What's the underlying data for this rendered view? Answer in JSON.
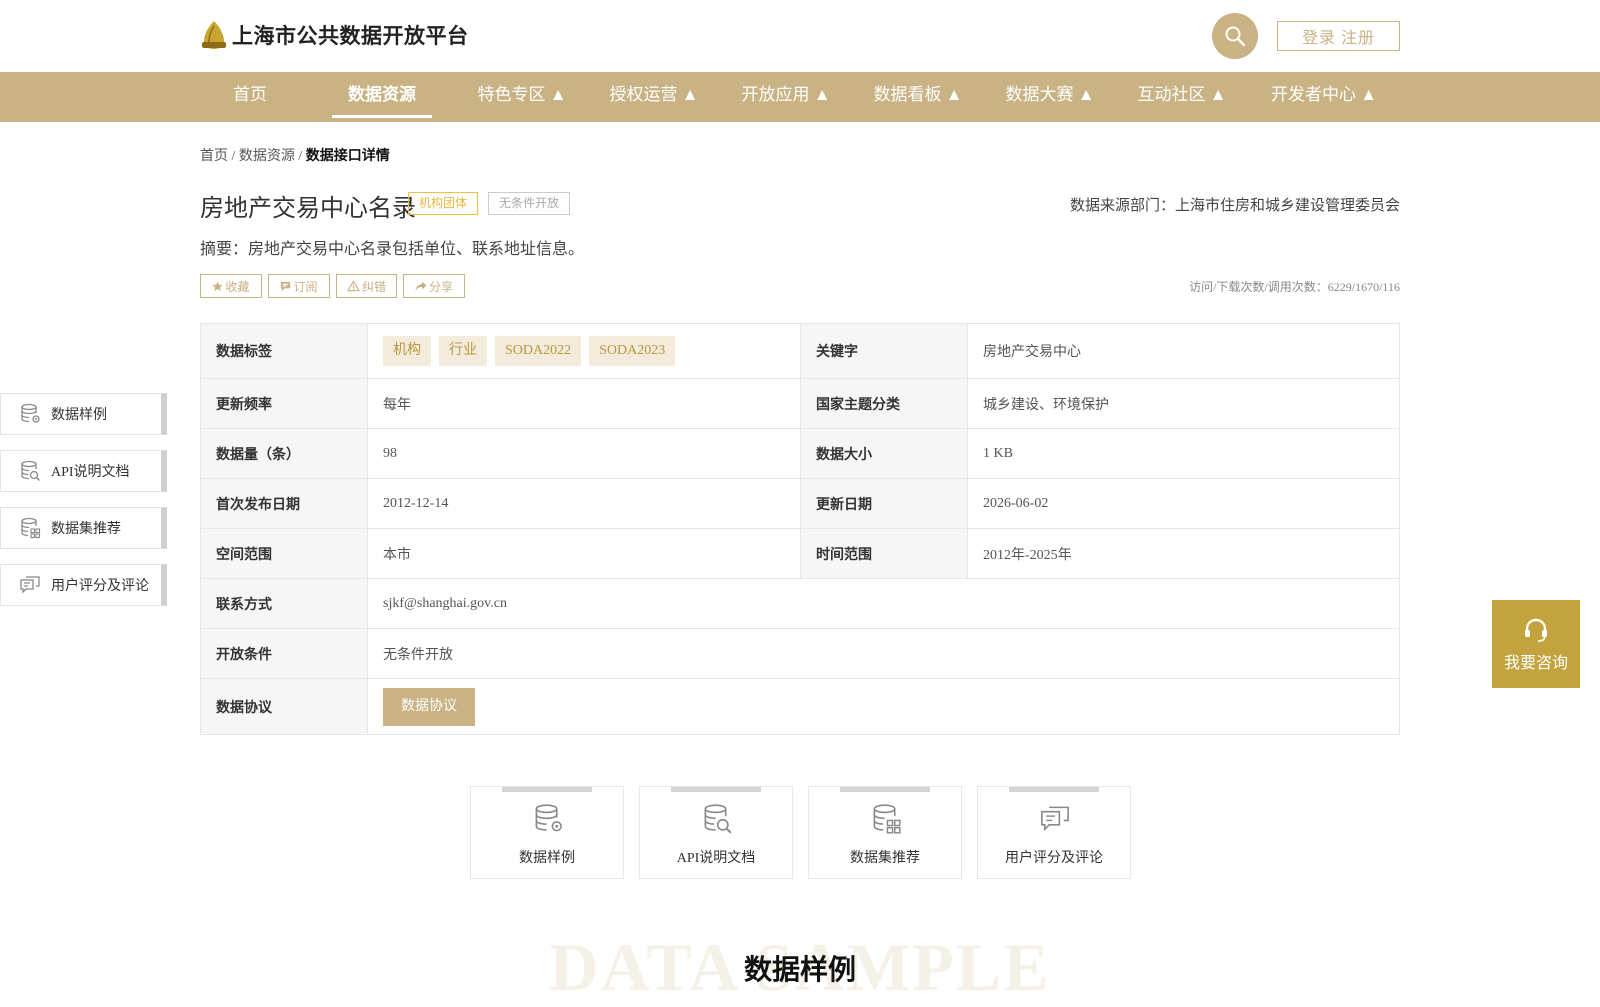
{
  "header": {
    "site_title": "上海市公共数据开放平台",
    "login_label": "登录 注册"
  },
  "nav": {
    "items": [
      {
        "label": "首页"
      },
      {
        "label": "数据资源"
      },
      {
        "label": "特色专区 ▲"
      },
      {
        "label": "授权运营 ▲"
      },
      {
        "label": "开放应用 ▲"
      },
      {
        "label": "数据看板 ▲"
      },
      {
        "label": "数据大赛 ▲"
      },
      {
        "label": "互动社区 ▲"
      },
      {
        "label": "开发者中心 ▲"
      }
    ],
    "active": "数据资源"
  },
  "breadcrumb": {
    "home": "首页",
    "sep1": " / ",
    "resources": "数据资源",
    "sep2": " / ",
    "current": "数据接口详情"
  },
  "dataset": {
    "title": "房地产交易中心名录",
    "tag_org": "机构团体",
    "tag_open": "无条件开放",
    "source": "数据来源部门：上海市住房和城乡建设管理委员会",
    "summary": "摘要：房地产交易中心名录包括单位、联系地址信息。",
    "stats": "访问/下载次数/调用次数：6229/1670/116"
  },
  "actions": {
    "favorite": "收藏",
    "subscribe": "订阅",
    "report": "纠错",
    "share": "分享"
  },
  "info": {
    "tags_label": "数据标签",
    "tags": [
      "机构",
      "行业",
      "SODA2022",
      "SODA2023"
    ],
    "keyword_label": "关键字",
    "keyword": "房地产交易中心",
    "freq_label": "更新频率",
    "freq": "每年",
    "theme_label": "国家主题分类",
    "theme": "城乡建设、环境保护",
    "count_label": "数据量（条）",
    "count": "98",
    "size_label": "数据大小",
    "size": "1 KB",
    "first_label": "首次发布日期",
    "first": "2012-12-14",
    "update_label": "更新日期",
    "update": "2026-06-02",
    "space_label": "空间范围",
    "space": "本市",
    "time_label": "时间范围",
    "time": "2012年-2025年",
    "contact_label": "联系方式",
    "contact": "sjkf@shanghai.gov.cn",
    "cond_label": "开放条件",
    "cond": "无条件开放",
    "agreement_label": "数据协议",
    "agreement_btn": "数据协议"
  },
  "side_nav": [
    {
      "label": "数据样例",
      "icon": "database-gear-icon"
    },
    {
      "label": "API说明文档",
      "icon": "database-search-icon"
    },
    {
      "label": "数据集推荐",
      "icon": "database-grid-icon"
    },
    {
      "label": "用户评分及评论",
      "icon": "comment-icon"
    }
  ],
  "consult": {
    "label": "我要咨询",
    "icon": "headset-icon"
  },
  "cards": [
    {
      "label": "数据样例",
      "icon": "database-gear-icon"
    },
    {
      "label": "API说明文档",
      "icon": "database-search-icon"
    },
    {
      "label": "数据集推荐",
      "icon": "database-grid-icon"
    },
    {
      "label": "用户评分及评论",
      "icon": "comment-icon"
    }
  ],
  "section": {
    "watermark": "DATA SAMPLE",
    "title": "数据样例"
  },
  "colors": {
    "accent": "#c9b283",
    "consult": "#c3a33d",
    "chip_bg": "#f3ecdc"
  }
}
